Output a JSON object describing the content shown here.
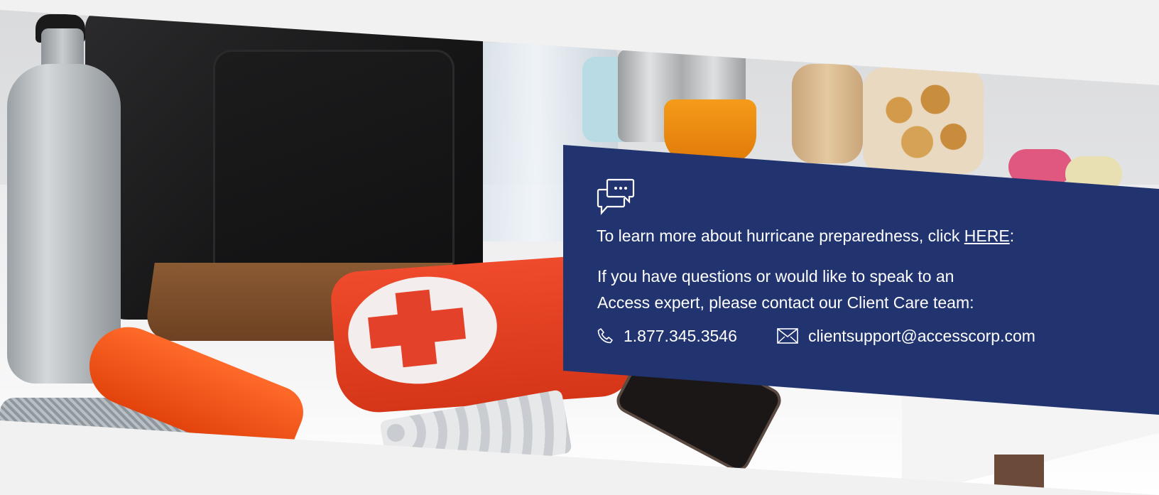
{
  "panel": {
    "icon": "chat-bubbles-icon",
    "line1_prefix": "To learn more about hurricane preparedness, click ",
    "line1_link": "HERE",
    "line1_suffix": ":",
    "paragraph_line1": "If you have questions or would like to speak to an",
    "paragraph_line2": "Access expert, please contact our Client Care team:",
    "phone_icon": "phone-icon",
    "phone": "1.877.345.3546",
    "email_icon": "envelope-icon",
    "email": "clientsupport@accesscorp.com"
  },
  "colors": {
    "panel_bg": "#22346f",
    "text": "#ffffff",
    "page_bg": "#f1f1f2"
  }
}
